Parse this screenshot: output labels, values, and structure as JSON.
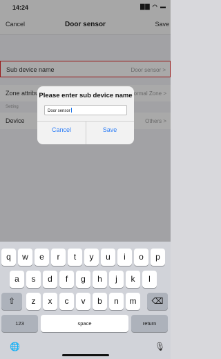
{
  "status": {
    "time": "14:24",
    "icons": "▇▇ ◠ ▬"
  },
  "nav": {
    "cancel": "Cancel",
    "title": "Door sensor",
    "save": "Save"
  },
  "rows": {
    "sub_device": {
      "label": "Sub device name",
      "value": "Door sensor >"
    },
    "zone": {
      "label": "Zone attribute",
      "value": "Normal Zone >"
    },
    "section": "Setting",
    "device": {
      "label": "Device",
      "value": "Others >"
    }
  },
  "dialog": {
    "title": "Please enter sub device name",
    "input_value": "Door sensor",
    "cancel": "Cancel",
    "save": "Save"
  },
  "keyboard": {
    "row1": [
      "q",
      "w",
      "e",
      "r",
      "t",
      "y",
      "u",
      "i",
      "o",
      "p"
    ],
    "row2": [
      "a",
      "s",
      "d",
      "f",
      "g",
      "h",
      "j",
      "k",
      "l"
    ],
    "row3": [
      "z",
      "x",
      "c",
      "v",
      "b",
      "n",
      "m"
    ],
    "shift": "⇧",
    "backspace": "⌫",
    "numbers": "123",
    "space": "space",
    "return": "return",
    "globe": "🌐",
    "mic": "🎙"
  }
}
